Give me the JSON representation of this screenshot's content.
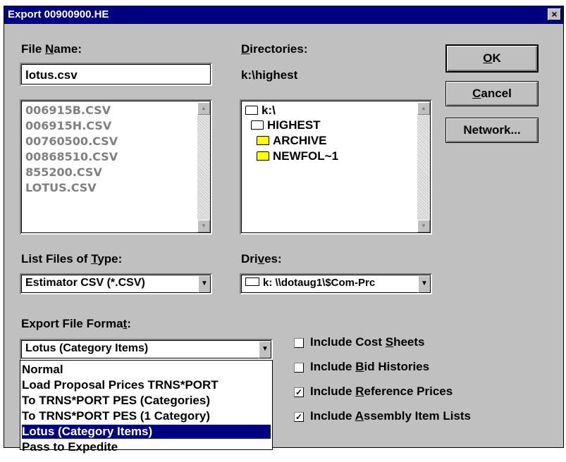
{
  "dialog": {
    "title": "Export 00900900.HE",
    "close_glyph": "×"
  },
  "file_name": {
    "label_pre": "File ",
    "label_u": "N",
    "label_post": "ame:",
    "value": "lotus.csv",
    "files": [
      "006915B.CSV",
      "006915H.CSV",
      "00760500.CSV",
      "00868510.CSV",
      "855200.CSV",
      "LOTUS.CSV"
    ]
  },
  "directories": {
    "label_u": "D",
    "label_post": "irectories:",
    "path": "k:\\highest",
    "items": [
      "k:\\",
      "HIGHEST",
      "ARCHIVE",
      "NEWFOL~1"
    ]
  },
  "buttons": {
    "ok_u": "O",
    "ok_post": "K",
    "cancel_u": "C",
    "cancel_post": "ancel",
    "network": "Network..."
  },
  "file_type": {
    "label_pre": "List Files of ",
    "label_u": "T",
    "label_post": "ype:",
    "value": "Estimator CSV (*.CSV)"
  },
  "drives": {
    "label_pre": "Dri",
    "label_u": "v",
    "label_post": "es:",
    "value": "k: \\\\dotaug1\\$Com-Prc"
  },
  "export_format": {
    "label_pre": "Export File Forma",
    "label_u": "t",
    "label_post": ":",
    "value": "Lotus (Category Items)",
    "options": [
      "Normal",
      "Load Proposal Prices TRNS*PORT",
      "To TRNS*PORT PES (Categories)",
      "To TRNS*PORT PES (1 Category)",
      "Lotus (Category Items)",
      "Pass to Expedite"
    ],
    "selected_index": 4
  },
  "checkboxes": [
    {
      "pre": "Include Cost ",
      "u": "S",
      "post": "heets",
      "checked": false,
      "mark": ""
    },
    {
      "pre": "Include ",
      "u": "B",
      "post": "id Histories",
      "checked": false,
      "mark": ""
    },
    {
      "pre": "Include ",
      "u": "R",
      "post": "eference Prices",
      "checked": true,
      "mark": "✓"
    },
    {
      "pre": "Include ",
      "u": "A",
      "post": "ssembly Item Lists",
      "checked": true,
      "mark": "✓"
    }
  ],
  "colors": {
    "titlebar": "#000080",
    "dialog_bg": "#c0c0c0",
    "selection": "#000080"
  }
}
